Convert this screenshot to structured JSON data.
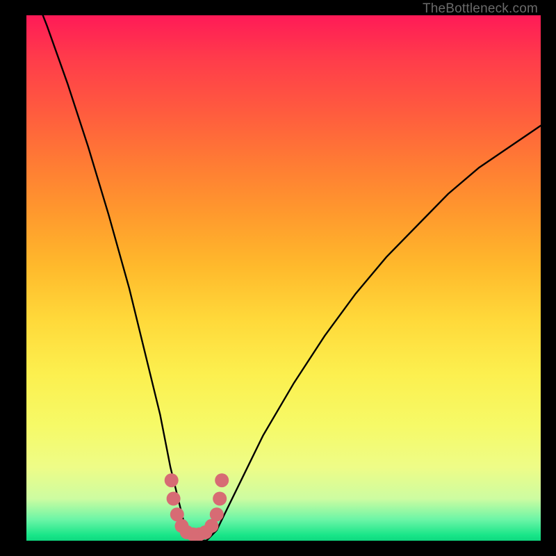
{
  "watermark": {
    "text": "TheBottleneck.com"
  },
  "chart_data": {
    "type": "line",
    "title": "",
    "xlabel": "",
    "ylabel": "",
    "xrange": [
      0,
      100
    ],
    "yrange": [
      0,
      100
    ],
    "note": "Single V-shaped bottleneck curve on a vertical color gradient. Y is bottleneck percentage (top=100, bottom=0). Colors: red(high) → green(0).",
    "series": [
      {
        "name": "bottleneck-curve",
        "x": [
          0,
          4,
          8,
          12,
          16,
          20,
          23,
          26,
          28,
          30,
          31,
          32,
          33,
          35,
          37,
          39,
          42,
          46,
          52,
          58,
          64,
          70,
          76,
          82,
          88,
          94,
          100
        ],
        "y": [
          108,
          98,
          87,
          75,
          62,
          48,
          36,
          24,
          14,
          6,
          2,
          0,
          0,
          0,
          2,
          6,
          12,
          20,
          30,
          39,
          47,
          54,
          60,
          66,
          71,
          75,
          79
        ]
      }
    ],
    "valley_marker": {
      "points_x": [
        28.2,
        28.6,
        29.3,
        30.2,
        31.2,
        32.4,
        33.6,
        34.8,
        36.0,
        37.0,
        37.6,
        38.0
      ],
      "points_y": [
        11.5,
        8.0,
        5.0,
        2.8,
        1.6,
        1.2,
        1.2,
        1.6,
        2.8,
        5.0,
        8.0,
        11.5
      ],
      "color": "#d76b74"
    },
    "gradient_stops": [
      {
        "pct": 0,
        "color": "#ff1a57"
      },
      {
        "pct": 18,
        "color": "#ff5a3f"
      },
      {
        "pct": 38,
        "color": "#ff9a2d"
      },
      {
        "pct": 58,
        "color": "#ffd93a"
      },
      {
        "pct": 78,
        "color": "#f6fa67"
      },
      {
        "pct": 92,
        "color": "#cdfca1"
      },
      {
        "pct": 99,
        "color": "#17e588"
      }
    ]
  }
}
